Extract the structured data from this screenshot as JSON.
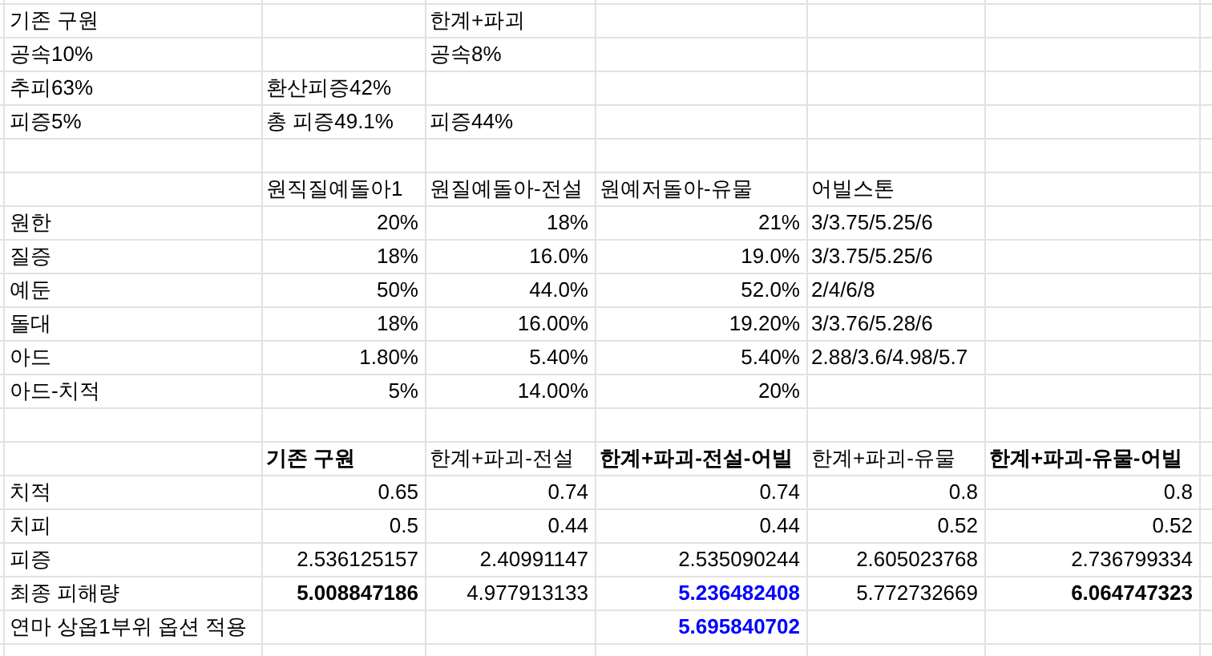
{
  "rows": [
    [
      {
        "text": "기존 구원",
        "kind": "label",
        "bold": false
      },
      null,
      {
        "text": "한계+파괴",
        "kind": "label",
        "bold": false
      },
      null,
      null,
      null
    ],
    [
      {
        "text": "공속10%",
        "kind": "label",
        "bold": false
      },
      null,
      {
        "text": "공속8%",
        "kind": "label",
        "bold": false
      },
      null,
      null,
      null
    ],
    [
      {
        "text": "추피63%",
        "kind": "label",
        "bold": false
      },
      {
        "text": "환산피증42%",
        "kind": "label",
        "bold": false
      },
      null,
      null,
      null,
      null
    ],
    [
      {
        "text": "피증5%",
        "kind": "label",
        "bold": false
      },
      {
        "text": "총 피증49.1%",
        "kind": "label",
        "bold": false
      },
      {
        "text": "피증44%",
        "kind": "label",
        "bold": false
      },
      null,
      null,
      null
    ],
    [
      null,
      null,
      null,
      null,
      null,
      null
    ],
    [
      null,
      {
        "text": "원직질예돌아1",
        "kind": "label",
        "bold": false
      },
      {
        "text": "원질예돌아-전설",
        "kind": "label",
        "bold": false
      },
      {
        "text": "원예저돌아-유물",
        "kind": "label",
        "bold": false
      },
      {
        "text": "어빌스톤",
        "kind": "label",
        "bold": false
      },
      null
    ],
    [
      {
        "text": "원한",
        "kind": "label",
        "bold": false
      },
      {
        "text": "20%",
        "kind": "number",
        "bold": false
      },
      {
        "text": "18%",
        "kind": "number",
        "bold": false
      },
      {
        "text": "21%",
        "kind": "number",
        "bold": false
      },
      {
        "text": "3/3.75/5.25/6",
        "kind": "label",
        "bold": false
      },
      null
    ],
    [
      {
        "text": "질증",
        "kind": "label",
        "bold": false
      },
      {
        "text": "18%",
        "kind": "number",
        "bold": false
      },
      {
        "text": "16.0%",
        "kind": "number",
        "bold": false
      },
      {
        "text": "19.0%",
        "kind": "number",
        "bold": false
      },
      {
        "text": "3/3.75/5.25/6",
        "kind": "label",
        "bold": false
      },
      null
    ],
    [
      {
        "text": "예둔",
        "kind": "label",
        "bold": false
      },
      {
        "text": "50%",
        "kind": "number",
        "bold": false
      },
      {
        "text": "44.0%",
        "kind": "number",
        "bold": false
      },
      {
        "text": "52.0%",
        "kind": "number",
        "bold": false
      },
      {
        "text": "2/4/6/8",
        "kind": "label",
        "bold": false
      },
      null
    ],
    [
      {
        "text": "돌대",
        "kind": "label",
        "bold": false
      },
      {
        "text": "18%",
        "kind": "number",
        "bold": false
      },
      {
        "text": "16.00%",
        "kind": "number",
        "bold": false
      },
      {
        "text": "19.20%",
        "kind": "number",
        "bold": false
      },
      {
        "text": "3/3.76/5.28/6",
        "kind": "label",
        "bold": false
      },
      null
    ],
    [
      {
        "text": "아드",
        "kind": "label",
        "bold": false
      },
      {
        "text": "1.80%",
        "kind": "number",
        "bold": false
      },
      {
        "text": "5.40%",
        "kind": "number",
        "bold": false
      },
      {
        "text": "5.40%",
        "kind": "number",
        "bold": false
      },
      {
        "text": "2.88/3.6/4.98/5.7",
        "kind": "label",
        "bold": false
      },
      null
    ],
    [
      {
        "text": "아드-치적",
        "kind": "label",
        "bold": false
      },
      {
        "text": "5%",
        "kind": "number",
        "bold": false
      },
      {
        "text": "14.00%",
        "kind": "number",
        "bold": false
      },
      {
        "text": "20%",
        "kind": "number",
        "bold": false
      },
      null,
      null
    ],
    [
      null,
      null,
      null,
      null,
      null,
      null
    ],
    [
      null,
      {
        "text": "기존 구원",
        "kind": "label",
        "bold": true
      },
      {
        "text": "한계+파괴-전설",
        "kind": "label",
        "bold": false
      },
      {
        "text": "한계+파괴-전설-어빌",
        "kind": "label",
        "bold": true
      },
      {
        "text": "한계+파괴-유물",
        "kind": "label",
        "bold": false
      },
      {
        "text": "한계+파괴-유물-어빌",
        "kind": "label",
        "bold": true
      }
    ],
    [
      {
        "text": "치적",
        "kind": "label",
        "bold": false
      },
      {
        "text": "0.65",
        "kind": "number",
        "bold": false
      },
      {
        "text": "0.74",
        "kind": "number",
        "bold": false
      },
      {
        "text": "0.74",
        "kind": "number",
        "bold": false
      },
      {
        "text": "0.8",
        "kind": "number",
        "bold": false
      },
      {
        "text": "0.8",
        "kind": "number",
        "bold": false
      }
    ],
    [
      {
        "text": "치피",
        "kind": "label",
        "bold": false
      },
      {
        "text": "0.5",
        "kind": "number",
        "bold": false
      },
      {
        "text": "0.44",
        "kind": "number",
        "bold": false
      },
      {
        "text": "0.44",
        "kind": "number",
        "bold": false
      },
      {
        "text": "0.52",
        "kind": "number",
        "bold": false
      },
      {
        "text": "0.52",
        "kind": "number",
        "bold": false
      }
    ],
    [
      {
        "text": "피증",
        "kind": "label",
        "bold": false
      },
      {
        "text": "2.536125157",
        "kind": "number",
        "bold": false
      },
      {
        "text": "2.40991147",
        "kind": "number",
        "bold": false
      },
      {
        "text": "2.535090244",
        "kind": "number",
        "bold": false
      },
      {
        "text": "2.605023768",
        "kind": "number",
        "bold": false
      },
      {
        "text": "2.736799334",
        "kind": "number",
        "bold": false
      }
    ],
    [
      {
        "text": "최종 피해량",
        "kind": "label",
        "bold": false
      },
      {
        "text": "5.008847186",
        "kind": "number",
        "bold": true
      },
      {
        "text": "4.977913133",
        "kind": "number",
        "bold": false
      },
      {
        "text": "5.236482408",
        "kind": "number",
        "bold": true,
        "color": "#0000ff"
      },
      {
        "text": "5.772732669",
        "kind": "number",
        "bold": false
      },
      {
        "text": "6.064747323",
        "kind": "number",
        "bold": true
      }
    ],
    [
      {
        "text": "연마 상옵1부위 옵션 적용",
        "kind": "label",
        "bold": false
      },
      null,
      null,
      {
        "text": "5.695840702",
        "kind": "number",
        "bold": true,
        "color": "#0000ff"
      },
      null,
      null
    ],
    [
      null,
      null,
      null,
      null,
      null,
      null
    ]
  ]
}
